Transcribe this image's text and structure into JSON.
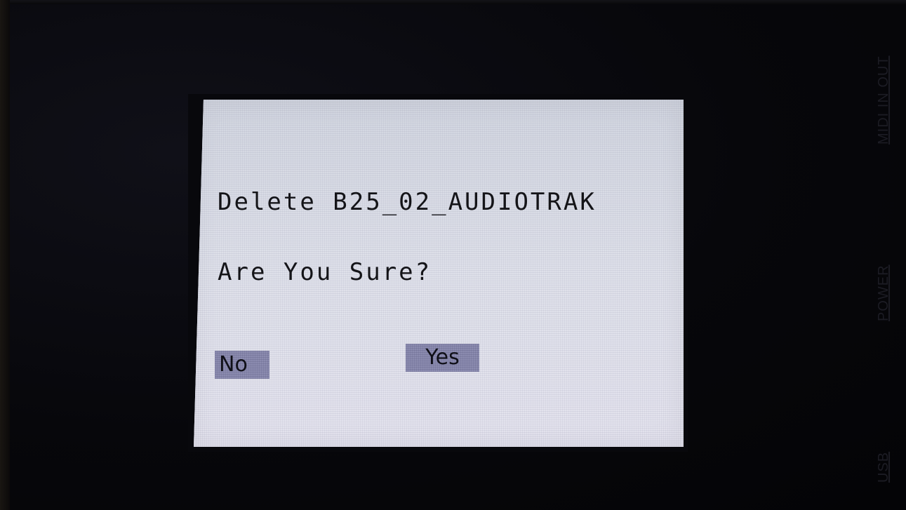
{
  "device": {
    "side_labels": {
      "midi": "MIDI IN OUT",
      "power": "POWER",
      "usb": "USB"
    }
  },
  "dialog": {
    "message": "Delete B25_02_AUDIOTRAK",
    "question": "Are You Sure?",
    "no_label": "No",
    "yes_label": "Yes"
  },
  "colors": {
    "screen_background": "#dcdfe9",
    "button_background": "#8c8cb0",
    "text": "#141418",
    "device_body": "#06060a"
  }
}
